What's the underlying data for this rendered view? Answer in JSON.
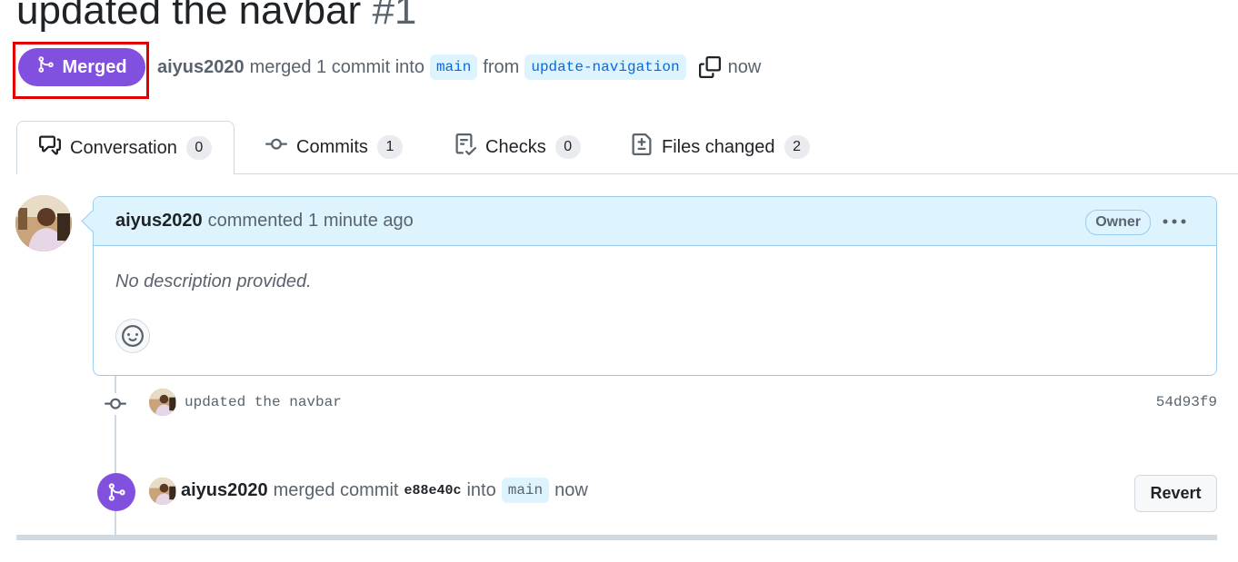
{
  "pr": {
    "title": "updated the navbar",
    "number": "#1",
    "status_label": "Merged",
    "author": "aiyus2020",
    "merged_text": "merged 1 commit into",
    "base_branch": "main",
    "from_text": "from",
    "head_branch": "update-navigation",
    "time": "now"
  },
  "tabs": [
    {
      "label": "Conversation",
      "count": "0",
      "icon": "comment-discussion-icon"
    },
    {
      "label": "Commits",
      "count": "1",
      "icon": "git-commit-icon"
    },
    {
      "label": "Checks",
      "count": "0",
      "icon": "checklist-icon"
    },
    {
      "label": "Files changed",
      "count": "2",
      "icon": "file-diff-icon"
    }
  ],
  "comment": {
    "author": "aiyus2020",
    "action": "commented",
    "time": "1 minute ago",
    "badge": "Owner",
    "body": "No description provided."
  },
  "timeline": {
    "commit_message": "updated the navbar",
    "commit_sha": "54d93f9",
    "merge_author": "aiyus2020",
    "merge_action": "merged commit",
    "merge_sha": "e88e40c",
    "merge_into": "into",
    "merge_branch": "main",
    "merge_time": "now",
    "revert_label": "Revert"
  },
  "colors": {
    "merged": "#8250df",
    "branch_bg": "#ddf4ff",
    "branch_fg": "#0969da",
    "highlight": "#e00000"
  }
}
